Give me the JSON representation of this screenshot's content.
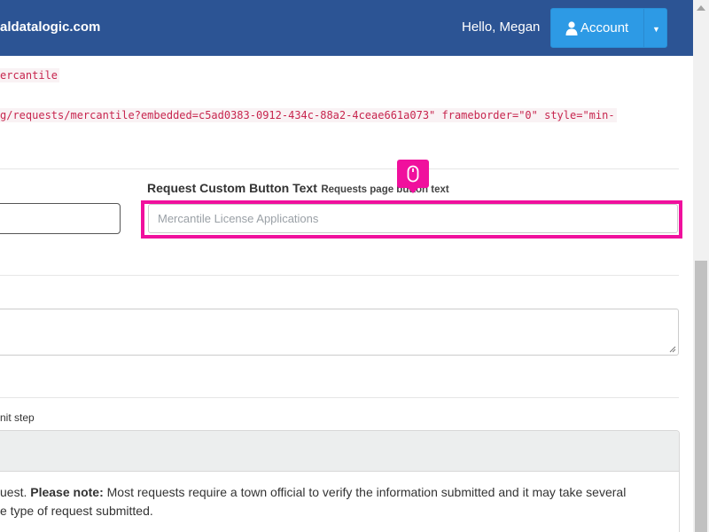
{
  "header": {
    "brand": "aldatalogic.com",
    "greeting": "Hello, Megan",
    "account_label": "Account",
    "account_icon": "user-icon",
    "caret_icon": "caret-down-icon"
  },
  "embed": {
    "name_code": "ercantile",
    "iframe_code": "g/requests/mercantile?embedded=c5ad0383-0912-434c-88a2-4ceae661a073\" frameborder=\"0\" style=\"min-"
  },
  "form": {
    "custom_button": {
      "label": "Request Custom Button Text",
      "help": "Requests page button text",
      "placeholder": "Mercantile License Applications"
    },
    "submit_step_label": "nit step",
    "panel_text_line1_pre": "uest. ",
    "panel_text_bold": "Please note:",
    "panel_text_line1_post": " Most requests require a town official to verify the information submitted and it may take several",
    "panel_text_line2": "e type of request submitted."
  },
  "overlay": {
    "highlight_color": "#f0109d",
    "badge_icon": "mouse-icon"
  },
  "colors": {
    "navbar": "#2c5494",
    "account_button": "#2d9ae5"
  }
}
